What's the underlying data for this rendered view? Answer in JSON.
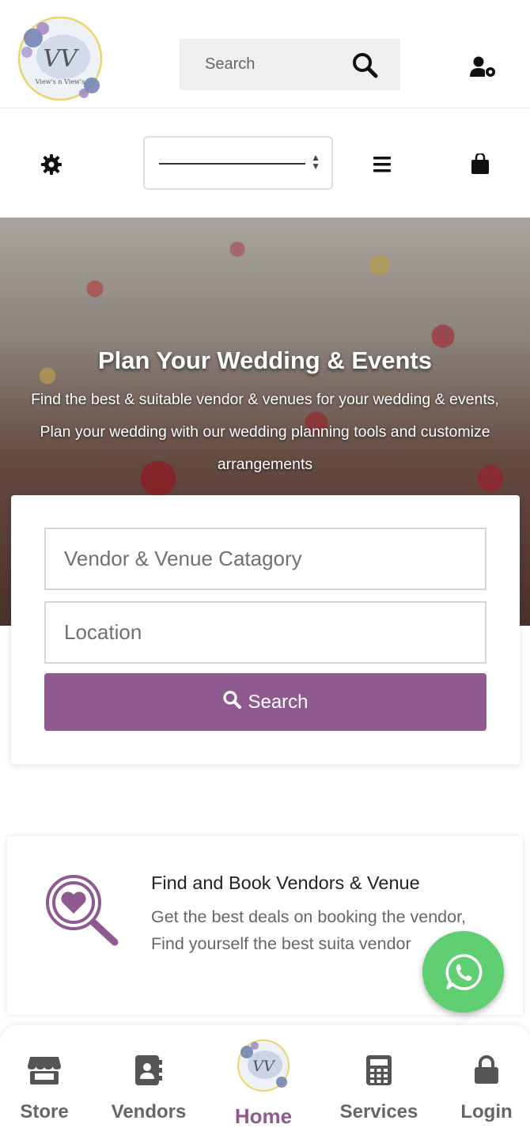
{
  "header": {
    "logo_text": "View's n View's",
    "search_placeholder": "Search"
  },
  "hero": {
    "title": "Plan Your Wedding & Events",
    "subtitle": "Find the best & suitable vendor & venues for your wedding & events, Plan your wedding with our wedding planning tools and customize arrangements"
  },
  "search_card": {
    "category_placeholder": "Vendor & Venue Catagory",
    "location_placeholder": "Location",
    "submit_label": "Search"
  },
  "feature": {
    "title": "Find and Book Vendors & Venue",
    "text": "Get the best deals on booking the vendor, Find yourself the best suita vendor"
  },
  "bottom_nav": {
    "items": [
      {
        "label": "Store",
        "icon": "store-icon"
      },
      {
        "label": "Vendors",
        "icon": "address-book-icon"
      },
      {
        "label": "Home",
        "icon": "logo-icon",
        "active": true
      },
      {
        "label": "Services",
        "icon": "calculator-icon"
      },
      {
        "label": "Login",
        "icon": "lock-icon"
      }
    ]
  },
  "colors": {
    "brand_purple": "#8f5a8f",
    "whatsapp_green": "#5fcf72"
  }
}
